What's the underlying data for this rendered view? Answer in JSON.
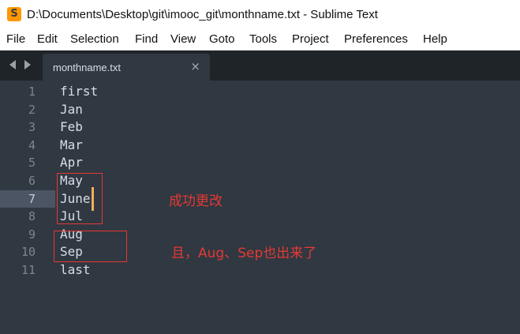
{
  "window": {
    "title": "D:\\Documents\\Desktop\\git\\imooc_git\\monthname.txt - Sublime Text",
    "app_icon_glyph": "S"
  },
  "menu": [
    "File",
    "Edit",
    "Selection",
    "Find",
    "View",
    "Goto",
    "Tools",
    "Project",
    "Preferences",
    "Help"
  ],
  "tab": {
    "label": "monthname.txt",
    "close_glyph": "×"
  },
  "editor": {
    "lines": [
      {
        "num": "1",
        "text": "first"
      },
      {
        "num": "2",
        "text": "Jan"
      },
      {
        "num": "3",
        "text": "Feb"
      },
      {
        "num": "4",
        "text": "Mar"
      },
      {
        "num": "5",
        "text": "Apr"
      },
      {
        "num": "6",
        "text": "May"
      },
      {
        "num": "7",
        "text": "June"
      },
      {
        "num": "8",
        "text": "Jul"
      },
      {
        "num": "9",
        "text": "Aug"
      },
      {
        "num": "10",
        "text": "Sep"
      },
      {
        "num": "11",
        "text": "last"
      }
    ],
    "active_line": "7"
  },
  "annotations": {
    "note1": "成功更改",
    "note2": "且，Aug、Sep也出来了"
  },
  "colors": {
    "editor_bg": "#303841",
    "tabbar_bg": "#1f2429",
    "caret": "#f9ae58",
    "annotation": "#e53935"
  }
}
